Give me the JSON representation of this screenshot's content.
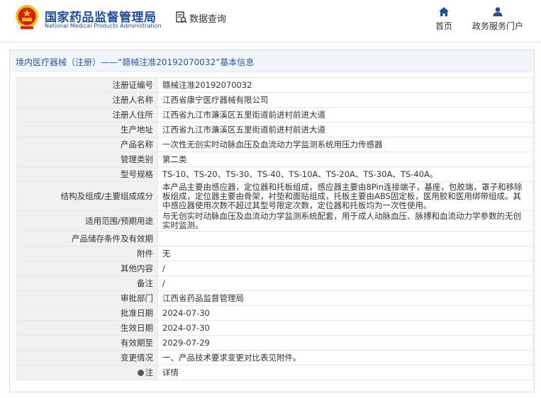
{
  "header": {
    "brand_cn": "国家药品监督管理局",
    "brand_en": "National Medical Products Administration",
    "search_label": "数据查询",
    "nav": {
      "home": "首页",
      "gov_portal": "政务服务门户"
    }
  },
  "panel": {
    "title": "境内医疗器械（注册）——“赣械注准20192070032”基本信息"
  },
  "rows": [
    {
      "key": "注册证编号",
      "value": "赣械注准20192070032"
    },
    {
      "key": "注册人名称",
      "value": "江西省康宁医疗器械有限公司"
    },
    {
      "key": "注册人住所",
      "value": "江西省九江市濂溪区五里街道前进村前进大道"
    },
    {
      "key": "生产地址",
      "value": "江西省九江市濂溪区五里街道前进村前进大道"
    },
    {
      "key": "产品名称",
      "value": "一次性无创实时动脉血压及血流动力学监测系统用压力传感器"
    },
    {
      "key": "管理类别",
      "value": "第二类"
    },
    {
      "key": "型号规格",
      "value": "TS-10、TS-20、TS-30、TS-40、TS-10A、TS-20A、TS-30A、TS-40A。"
    },
    {
      "key": "结构及组成/主要组成成分",
      "value": "本产品主要由感应器，定位器和托板组成，感应器主要由8Pin连接端子，基座，包胶端，罩子和移除板组成，定位器主要由骨架，衬垫和面贴组成，托板主要由ABS固定板，医用胶和医用绑带组成。其中感应器使用次数不超过其型号限定次数，定位器和托板均为一次性使用。"
    },
    {
      "key": "适用范围/预期用途",
      "value": "与无创实时动脉血压及血流动力学监测系统配套，用于成人动脉血压、脉搏和血流动力学参数的无创实时监测。"
    },
    {
      "key": "产品储存条件及有效期",
      "value": ""
    },
    {
      "key": "附件",
      "value": "无"
    },
    {
      "key": "其他内容",
      "value": "/"
    },
    {
      "key": "备注",
      "value": "/"
    },
    {
      "key": "审批部门",
      "value": "江西省药品监督管理局"
    },
    {
      "key": "批准日期",
      "value": "2024-07-30"
    },
    {
      "key": "生效日期",
      "value": "2024-07-30"
    },
    {
      "key": "有效期至",
      "value": "2029-07-29"
    },
    {
      "key": "变更情况",
      "value": "一、产品技术要求变更对比表见附件。"
    },
    {
      "key": "注",
      "value": "详情"
    }
  ],
  "colors": {
    "brand_blue": "#1f4e9c",
    "link_blue": "#2a5aa8",
    "emblem_red": "#d21f1f",
    "emblem_gold": "#f2c200"
  }
}
